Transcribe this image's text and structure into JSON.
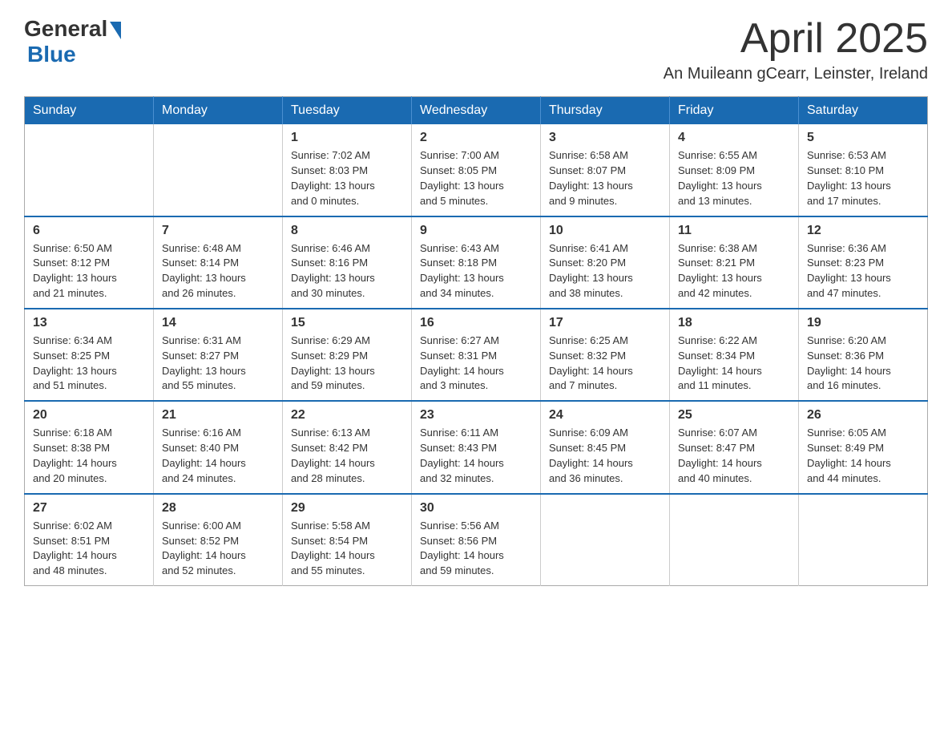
{
  "header": {
    "logo_general": "General",
    "logo_blue": "Blue",
    "month_title": "April 2025",
    "location": "An Muileann gCearr, Leinster, Ireland"
  },
  "days_of_week": [
    "Sunday",
    "Monday",
    "Tuesday",
    "Wednesday",
    "Thursday",
    "Friday",
    "Saturday"
  ],
  "weeks": [
    [
      {
        "day": "",
        "info": ""
      },
      {
        "day": "",
        "info": ""
      },
      {
        "day": "1",
        "info": "Sunrise: 7:02 AM\nSunset: 8:03 PM\nDaylight: 13 hours\nand 0 minutes."
      },
      {
        "day": "2",
        "info": "Sunrise: 7:00 AM\nSunset: 8:05 PM\nDaylight: 13 hours\nand 5 minutes."
      },
      {
        "day": "3",
        "info": "Sunrise: 6:58 AM\nSunset: 8:07 PM\nDaylight: 13 hours\nand 9 minutes."
      },
      {
        "day": "4",
        "info": "Sunrise: 6:55 AM\nSunset: 8:09 PM\nDaylight: 13 hours\nand 13 minutes."
      },
      {
        "day": "5",
        "info": "Sunrise: 6:53 AM\nSunset: 8:10 PM\nDaylight: 13 hours\nand 17 minutes."
      }
    ],
    [
      {
        "day": "6",
        "info": "Sunrise: 6:50 AM\nSunset: 8:12 PM\nDaylight: 13 hours\nand 21 minutes."
      },
      {
        "day": "7",
        "info": "Sunrise: 6:48 AM\nSunset: 8:14 PM\nDaylight: 13 hours\nand 26 minutes."
      },
      {
        "day": "8",
        "info": "Sunrise: 6:46 AM\nSunset: 8:16 PM\nDaylight: 13 hours\nand 30 minutes."
      },
      {
        "day": "9",
        "info": "Sunrise: 6:43 AM\nSunset: 8:18 PM\nDaylight: 13 hours\nand 34 minutes."
      },
      {
        "day": "10",
        "info": "Sunrise: 6:41 AM\nSunset: 8:20 PM\nDaylight: 13 hours\nand 38 minutes."
      },
      {
        "day": "11",
        "info": "Sunrise: 6:38 AM\nSunset: 8:21 PM\nDaylight: 13 hours\nand 42 minutes."
      },
      {
        "day": "12",
        "info": "Sunrise: 6:36 AM\nSunset: 8:23 PM\nDaylight: 13 hours\nand 47 minutes."
      }
    ],
    [
      {
        "day": "13",
        "info": "Sunrise: 6:34 AM\nSunset: 8:25 PM\nDaylight: 13 hours\nand 51 minutes."
      },
      {
        "day": "14",
        "info": "Sunrise: 6:31 AM\nSunset: 8:27 PM\nDaylight: 13 hours\nand 55 minutes."
      },
      {
        "day": "15",
        "info": "Sunrise: 6:29 AM\nSunset: 8:29 PM\nDaylight: 13 hours\nand 59 minutes."
      },
      {
        "day": "16",
        "info": "Sunrise: 6:27 AM\nSunset: 8:31 PM\nDaylight: 14 hours\nand 3 minutes."
      },
      {
        "day": "17",
        "info": "Sunrise: 6:25 AM\nSunset: 8:32 PM\nDaylight: 14 hours\nand 7 minutes."
      },
      {
        "day": "18",
        "info": "Sunrise: 6:22 AM\nSunset: 8:34 PM\nDaylight: 14 hours\nand 11 minutes."
      },
      {
        "day": "19",
        "info": "Sunrise: 6:20 AM\nSunset: 8:36 PM\nDaylight: 14 hours\nand 16 minutes."
      }
    ],
    [
      {
        "day": "20",
        "info": "Sunrise: 6:18 AM\nSunset: 8:38 PM\nDaylight: 14 hours\nand 20 minutes."
      },
      {
        "day": "21",
        "info": "Sunrise: 6:16 AM\nSunset: 8:40 PM\nDaylight: 14 hours\nand 24 minutes."
      },
      {
        "day": "22",
        "info": "Sunrise: 6:13 AM\nSunset: 8:42 PM\nDaylight: 14 hours\nand 28 minutes."
      },
      {
        "day": "23",
        "info": "Sunrise: 6:11 AM\nSunset: 8:43 PM\nDaylight: 14 hours\nand 32 minutes."
      },
      {
        "day": "24",
        "info": "Sunrise: 6:09 AM\nSunset: 8:45 PM\nDaylight: 14 hours\nand 36 minutes."
      },
      {
        "day": "25",
        "info": "Sunrise: 6:07 AM\nSunset: 8:47 PM\nDaylight: 14 hours\nand 40 minutes."
      },
      {
        "day": "26",
        "info": "Sunrise: 6:05 AM\nSunset: 8:49 PM\nDaylight: 14 hours\nand 44 minutes."
      }
    ],
    [
      {
        "day": "27",
        "info": "Sunrise: 6:02 AM\nSunset: 8:51 PM\nDaylight: 14 hours\nand 48 minutes."
      },
      {
        "day": "28",
        "info": "Sunrise: 6:00 AM\nSunset: 8:52 PM\nDaylight: 14 hours\nand 52 minutes."
      },
      {
        "day": "29",
        "info": "Sunrise: 5:58 AM\nSunset: 8:54 PM\nDaylight: 14 hours\nand 55 minutes."
      },
      {
        "day": "30",
        "info": "Sunrise: 5:56 AM\nSunset: 8:56 PM\nDaylight: 14 hours\nand 59 minutes."
      },
      {
        "day": "",
        "info": ""
      },
      {
        "day": "",
        "info": ""
      },
      {
        "day": "",
        "info": ""
      }
    ]
  ]
}
